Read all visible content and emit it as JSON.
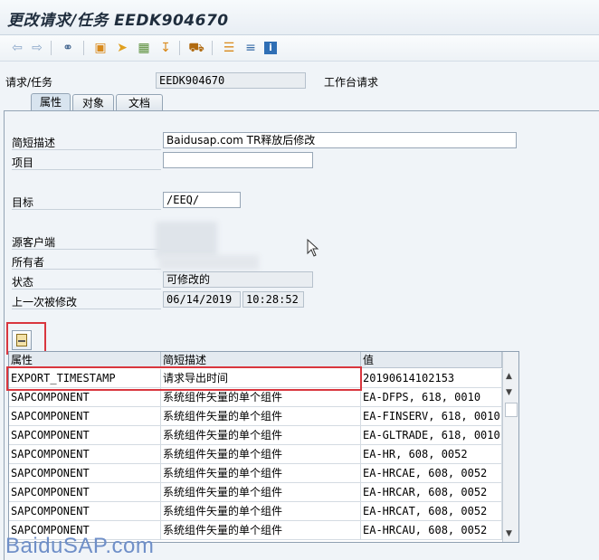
{
  "window": {
    "title": "更改请求/任务 EEDK904670"
  },
  "toolbar": {
    "icons": [
      "back-arrow-icon",
      "forward-arrow-icon",
      "glasses-display-icon",
      "object-icon",
      "move-icon",
      "hierarchy-icon",
      "import-icon",
      "truck-icon",
      "tree-icon",
      "align-icon",
      "info-icon"
    ]
  },
  "header": {
    "request_label": "请求/任务",
    "request_value": "EEDK904670",
    "request_type": "工作台请求"
  },
  "tabs": [
    "属性",
    "对象",
    "文档"
  ],
  "form": {
    "short_desc_label": "简短描述",
    "short_desc_value": "Baidusap.com TR释放后修改",
    "project_label": "项目",
    "project_value": "",
    "target_label": "目标",
    "target_value": "/EEQ/",
    "source_client_label": "源客户端",
    "owner_label": "所有者",
    "status_label": "状态",
    "status_value": "可修改的",
    "last_changed_label": "上一次被修改",
    "last_changed_date": "06/14/2019",
    "last_changed_time": "10:28:52"
  },
  "grid": {
    "columns": [
      "属性",
      "简短描述",
      "值"
    ],
    "rows": [
      [
        "EXPORT_TIMESTAMP",
        "请求导出时间",
        "20190614102153"
      ],
      [
        "SAPCOMPONENT",
        "系统组件矢量的单个组件",
        "EA-DFPS, 618, 0010"
      ],
      [
        "SAPCOMPONENT",
        "系统组件矢量的单个组件",
        "EA-FINSERV, 618, 0010"
      ],
      [
        "SAPCOMPONENT",
        "系统组件矢量的单个组件",
        "EA-GLTRADE, 618, 0010"
      ],
      [
        "SAPCOMPONENT",
        "系统组件矢量的单个组件",
        "EA-HR, 608, 0052"
      ],
      [
        "SAPCOMPONENT",
        "系统组件矢量的单个组件",
        "EA-HRCAE, 608, 0052"
      ],
      [
        "SAPCOMPONENT",
        "系统组件矢量的单个组件",
        "EA-HRCAR, 608, 0052"
      ],
      [
        "SAPCOMPONENT",
        "系统组件矢量的单个组件",
        "EA-HRCAT, 608, 0052"
      ],
      [
        "SAPCOMPONENT",
        "系统组件矢量的单个组件",
        "EA-HRCAU, 608, 0052"
      ]
    ]
  },
  "watermark": "BaiduSAP.com",
  "colors": {
    "highlight": "#d9363e",
    "accent": "#2f6fb5"
  }
}
